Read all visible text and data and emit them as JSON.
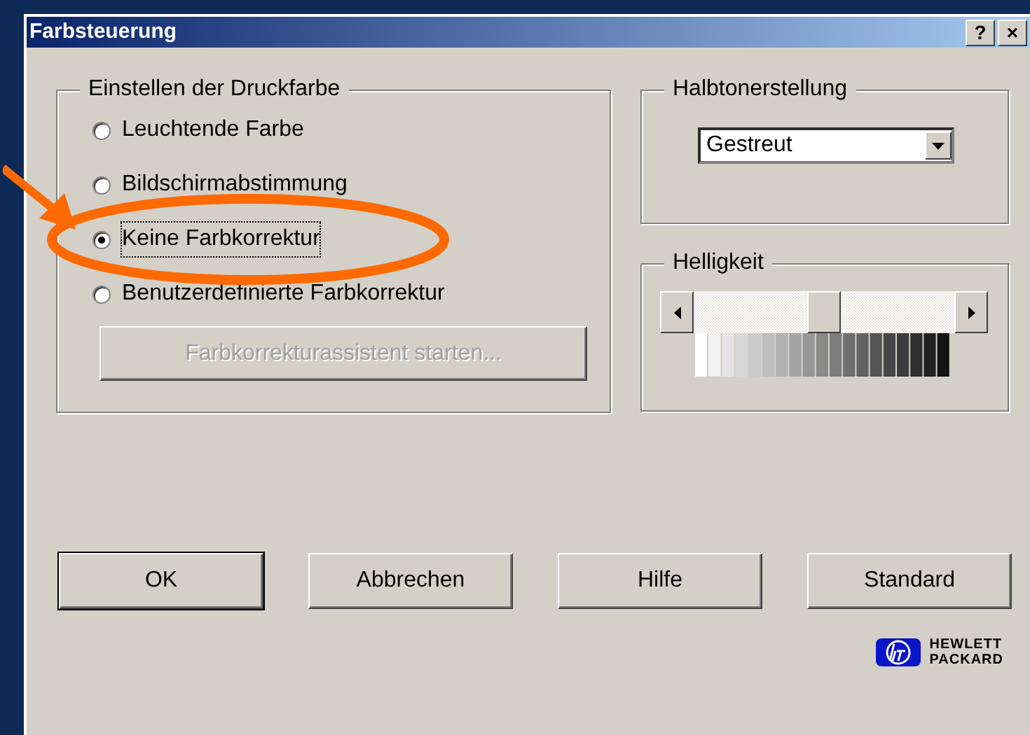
{
  "window": {
    "title": "Farbsteuerung",
    "help_button": "?",
    "close_button": "×"
  },
  "print_color": {
    "label": "Einstellen der Druckfarbe",
    "options": [
      {
        "label": "Leuchtende Farbe",
        "selected": false
      },
      {
        "label": "Bildschirmabstimmung",
        "selected": false
      },
      {
        "label": "Keine Farbkorrektur",
        "selected": true
      },
      {
        "label": "Benutzerdefinierte Farbkorrektur",
        "selected": false
      }
    ],
    "button": {
      "label": "Farbkorrekturassistent starten...",
      "disabled": true
    }
  },
  "halftone": {
    "label": "Halbtonerstellung",
    "value": "Gestreut"
  },
  "brightness": {
    "label": "Helligkeit",
    "level": 0.5
  },
  "buttons": [
    {
      "label": "OK",
      "default": true
    },
    {
      "label": "Abbrechen",
      "default": false
    },
    {
      "label": "Hilfe",
      "default": false
    },
    {
      "label": "Standard",
      "default": false
    }
  ],
  "logo": {
    "line_1": "HEWLETT",
    "line_2": "PACKARD"
  }
}
